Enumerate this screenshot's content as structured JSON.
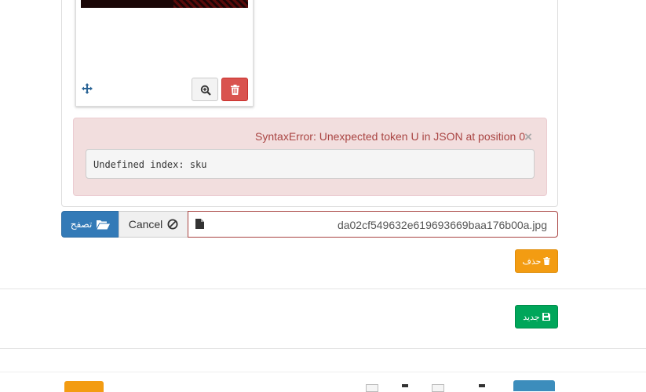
{
  "upload": {
    "preview": {
      "move_icon": "arrows-move-icon",
      "zoom_icon": "zoom-in-icon",
      "delete_icon": "trash-icon"
    },
    "error": {
      "message": "SyntaxError: Unexpected token U in JSON at position 0",
      "close": "×",
      "detail": "Undefined index: sku"
    },
    "browse_label": "تصفح",
    "cancel_label": "Cancel",
    "file_name": "da02cf549632e619693669baa176b00a.jpg"
  },
  "actions": {
    "delete_label": "حذف",
    "new_label": "جديد"
  },
  "colors": {
    "primary": "#337ab7",
    "danger": "#d9534f",
    "warning": "#f39c12",
    "success": "#00a65a",
    "alert_bg": "#f2dede",
    "alert_text": "#a94442"
  }
}
